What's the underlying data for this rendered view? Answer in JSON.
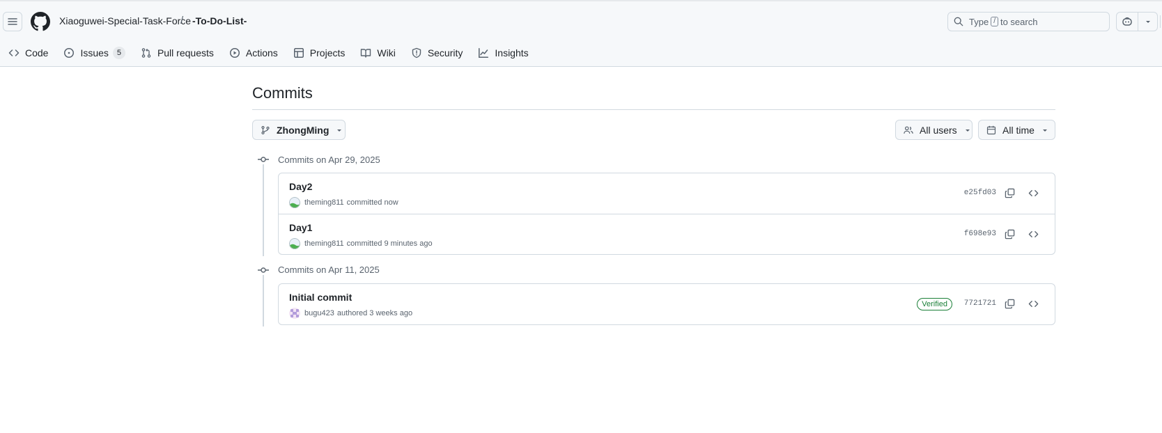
{
  "header": {
    "owner": "Xiaoguwei-Special-Task-Force",
    "separator": "/",
    "repo": "-To-Do-List-",
    "search": {
      "prefix": "Type",
      "key": "/",
      "suffix": "to search"
    }
  },
  "tabs": [
    {
      "label": "Code",
      "icon": "code-icon"
    },
    {
      "label": "Issues",
      "icon": "issue-opened-icon",
      "count": "5"
    },
    {
      "label": "Pull requests",
      "icon": "git-pull-request-icon"
    },
    {
      "label": "Actions",
      "icon": "play-icon"
    },
    {
      "label": "Projects",
      "icon": "table-icon"
    },
    {
      "label": "Wiki",
      "icon": "book-icon"
    },
    {
      "label": "Security",
      "icon": "shield-icon"
    },
    {
      "label": "Insights",
      "icon": "graph-icon"
    }
  ],
  "main": {
    "title": "Commits",
    "branch": "ZhongMing",
    "users_filter": "All users",
    "time_filter": "All time"
  },
  "groups": [
    {
      "label": "Commits on Apr 29, 2025",
      "commits": [
        {
          "message": "Day2",
          "author": "theming811",
          "action": "committed now",
          "sha": "e25fd03",
          "verified": ""
        },
        {
          "message": "Day1",
          "author": "theming811",
          "action": "committed 9 minutes ago",
          "sha": "f698e93",
          "verified": ""
        }
      ]
    },
    {
      "label": "Commits on Apr 11, 2025",
      "commits": [
        {
          "message": "Initial commit",
          "author": "bugu423",
          "action": "authored 3 weeks ago",
          "sha": "7721721",
          "verified": "Verified"
        }
      ]
    }
  ],
  "colors": {
    "accent_green": "#1a7f37",
    "border": "#d1d9e0",
    "muted_text": "#59636e",
    "header_bg": "#f6f8fa"
  }
}
